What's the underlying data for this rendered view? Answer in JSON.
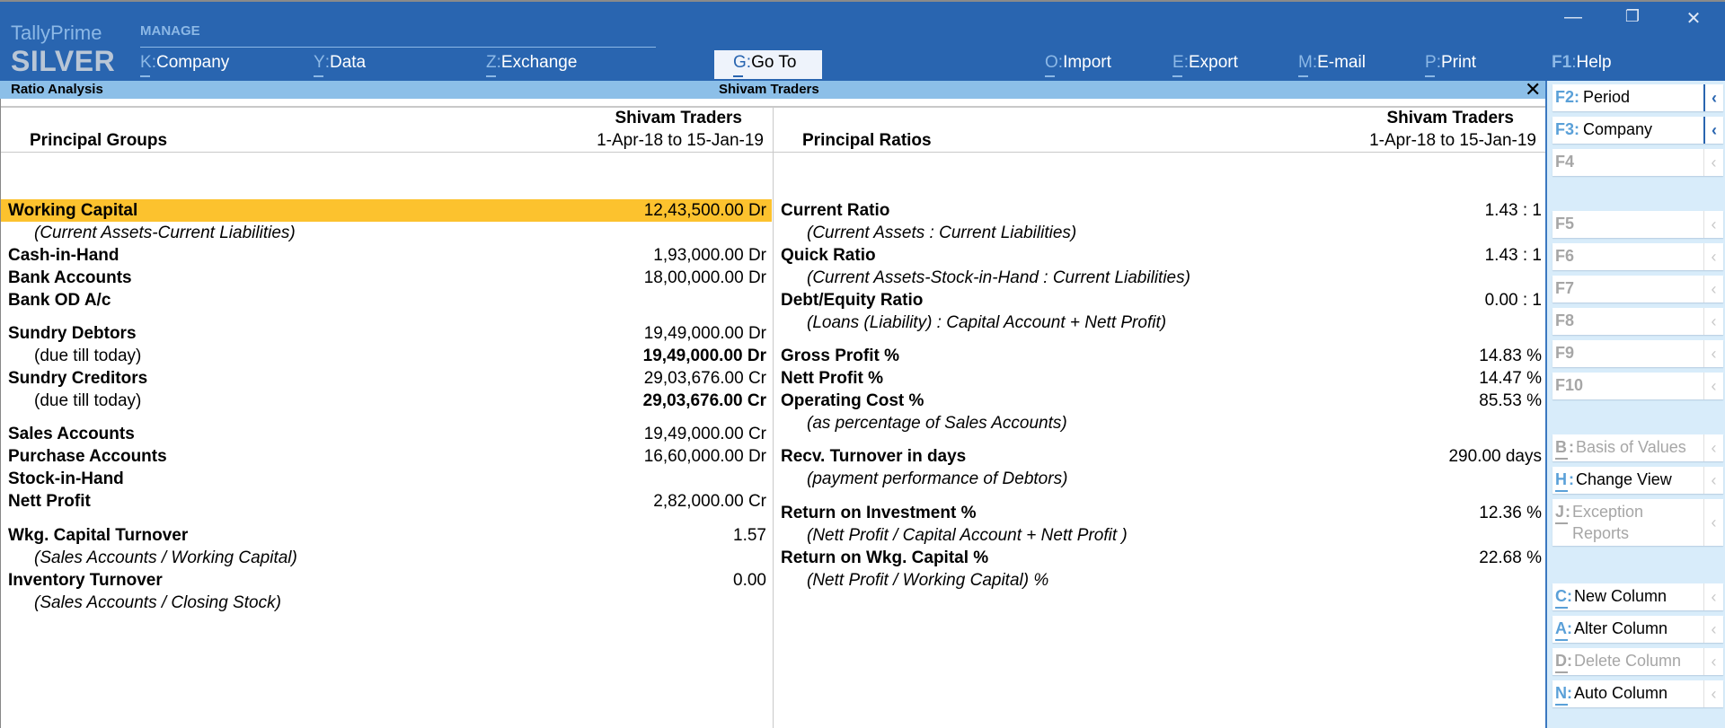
{
  "app": {
    "brand_line1": "TallyPrime",
    "brand_line2": "SILVER",
    "menu_group_label": "MANAGE"
  },
  "topmenu": [
    {
      "key": "K",
      "label": "Company"
    },
    {
      "key": "Y",
      "label": "Data"
    },
    {
      "key": "Z",
      "label": "Exchange"
    },
    {
      "key": "G",
      "label": "Go To"
    },
    {
      "key": "O",
      "label": "Import"
    },
    {
      "key": "E",
      "label": "Export"
    },
    {
      "key": "M",
      "label": "E-mail"
    },
    {
      "key": "P",
      "label": "Print"
    },
    {
      "key": "F1",
      "label": "Help"
    }
  ],
  "window_controls": {
    "minimize": "—",
    "restore": "❐",
    "close": "✕"
  },
  "titlebar": {
    "report_name": "Ratio Analysis",
    "company": "Shivam Traders",
    "close": "✕"
  },
  "left_panel": {
    "title": "Principal Groups",
    "column_company": "Shivam Traders",
    "column_period": "1-Apr-18 to 15-Jan-19",
    "rows": [
      {
        "label": "Working Capital",
        "value": "12,43,500.00 Dr"
      },
      {
        "label": "(Current Assets-Current Liabilities)",
        "value": ""
      },
      {
        "label": "Cash-in-Hand",
        "value": "1,93,000.00 Dr"
      },
      {
        "label": "Bank Accounts",
        "value": "18,00,000.00 Dr"
      },
      {
        "label": "Bank OD A/c",
        "value": ""
      },
      {
        "label": "Sundry Debtors",
        "value": "19,49,000.00 Dr"
      },
      {
        "label": "(due till today)",
        "value": "19,49,000.00 Dr"
      },
      {
        "label": "Sundry Creditors",
        "value": "29,03,676.00 Cr"
      },
      {
        "label": "(due till today)",
        "value": "29,03,676.00 Cr"
      },
      {
        "label": "Sales Accounts",
        "value": "19,49,000.00 Cr"
      },
      {
        "label": "Purchase Accounts",
        "value": "16,60,000.00 Dr"
      },
      {
        "label": "Stock-in-Hand",
        "value": ""
      },
      {
        "label": "Nett Profit",
        "value": "2,82,000.00 Cr"
      },
      {
        "label": "Wkg. Capital Turnover",
        "value": "1.57"
      },
      {
        "label": "(Sales Accounts / Working Capital)",
        "value": ""
      },
      {
        "label": "Inventory Turnover",
        "value": "0.00"
      },
      {
        "label": "(Sales Accounts / Closing Stock)",
        "value": ""
      }
    ]
  },
  "right_panel": {
    "title": "Principal Ratios",
    "column_company": "Shivam Traders",
    "column_period": "1-Apr-18 to 15-Jan-19",
    "rows": [
      {
        "label": "Current Ratio",
        "value": "1.43 : 1"
      },
      {
        "label": "(Current Assets : Current Liabilities)",
        "value": ""
      },
      {
        "label": "Quick Ratio",
        "value": "1.43 : 1"
      },
      {
        "label": "(Current Assets-Stock-in-Hand : Current Liabilities)",
        "value": ""
      },
      {
        "label": "Debt/Equity Ratio",
        "value": "0.00 : 1"
      },
      {
        "label": "(Loans (Liability) : Capital Account + Nett Profit)",
        "value": ""
      },
      {
        "label": "Gross Profit %",
        "value": "14.83 %"
      },
      {
        "label": "Nett Profit %",
        "value": "14.47 %"
      },
      {
        "label": "Operating Cost %",
        "value": "85.53 %"
      },
      {
        "label": "(as percentage of Sales Accounts)",
        "value": ""
      },
      {
        "label": "Recv. Turnover in days",
        "value": "290.00 days"
      },
      {
        "label": "(payment performance of Debtors)",
        "value": ""
      },
      {
        "label": "Return on Investment %",
        "value": "12.36 %"
      },
      {
        "label": "(Nett Profit / Capital Account + Nett Profit )",
        "value": ""
      },
      {
        "label": "Return on Wkg. Capital %",
        "value": "22.68 %"
      },
      {
        "label": "(Nett Profit / Working Capital) %",
        "value": ""
      }
    ]
  },
  "sidebar": [
    {
      "key": "F2",
      "label": "Period",
      "enabled": true
    },
    {
      "key": "F3",
      "label": "Company",
      "enabled": true
    },
    {
      "key": "F4",
      "label": "",
      "enabled": false
    },
    {
      "key": "F5",
      "label": "",
      "enabled": false
    },
    {
      "key": "F6",
      "label": "",
      "enabled": false
    },
    {
      "key": "F7",
      "label": "",
      "enabled": false
    },
    {
      "key": "F8",
      "label": "",
      "enabled": false
    },
    {
      "key": "F9",
      "label": "",
      "enabled": false
    },
    {
      "key": "F10",
      "label": "",
      "enabled": false
    },
    {
      "key": "B",
      "label": "Basis of Values",
      "enabled": false
    },
    {
      "key": "H",
      "label": "Change View",
      "enabled": true
    },
    {
      "key": "J",
      "label": "Exception",
      "label2": "Reports",
      "enabled": false
    },
    {
      "key": "C",
      "label": "New Column",
      "enabled": true
    },
    {
      "key": "A",
      "label": "Alter Column",
      "enabled": true
    },
    {
      "key": "D",
      "label": "Delete Column",
      "enabled": false
    },
    {
      "key": "N",
      "label": "Auto Column",
      "enabled": true
    }
  ],
  "sidebar_chevron": "‹",
  "colors": {
    "topbar": "#2965b0",
    "title_strip": "#8cbfe8",
    "selected_row": "#fcc22e",
    "sidebar_bg": "#d8ecfa",
    "key_accent": "#5aa0d8"
  }
}
